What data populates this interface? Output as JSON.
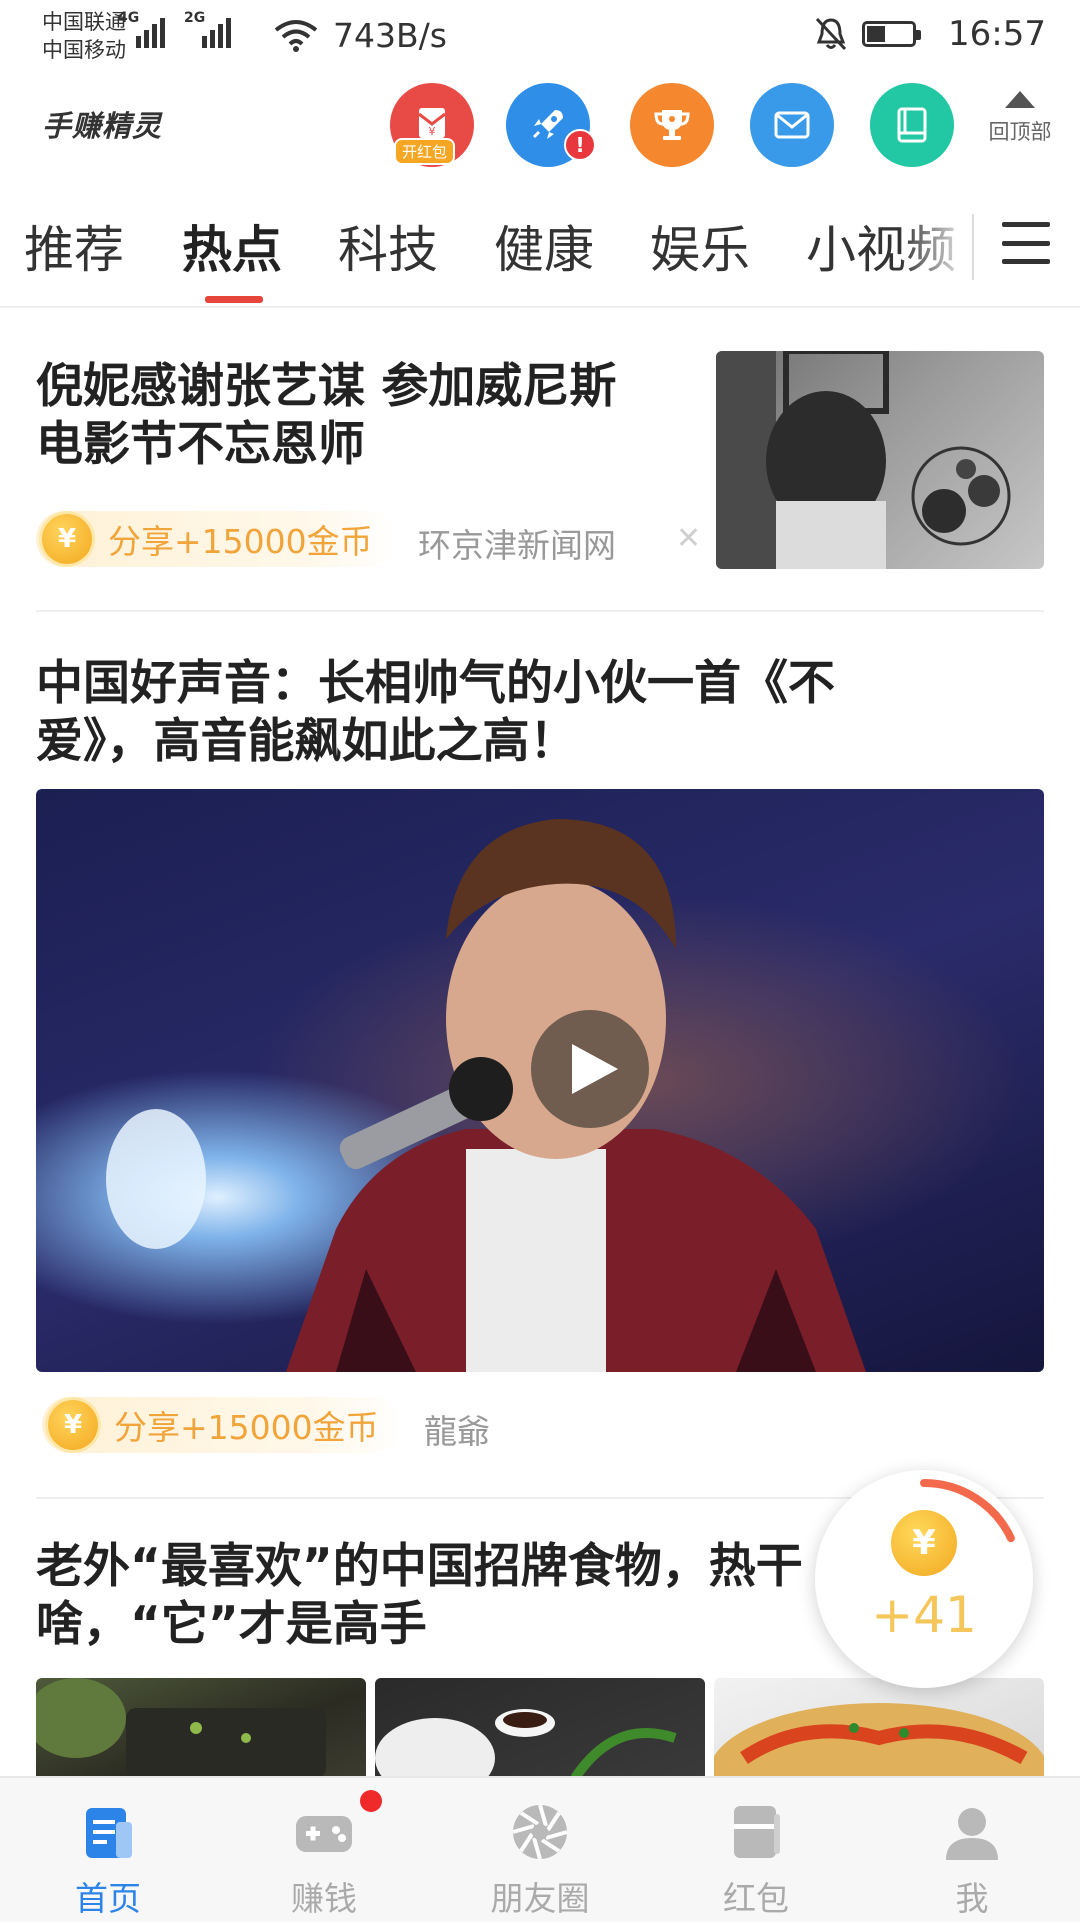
{
  "status_bar": {
    "carrier1": "中国联通",
    "carrier2": "中国移动",
    "net1": "4G",
    "net2": "2G",
    "speed": "743B/s",
    "time": "16:57",
    "icons": [
      "signal-icon",
      "wifi-icon",
      "mute-bell-icon",
      "battery-icon"
    ]
  },
  "header": {
    "logo": "手赚精灵",
    "icons": [
      {
        "name": "red-packet-icon",
        "badge": "开红包",
        "color": "#e84b46"
      },
      {
        "name": "rocket-icon",
        "alert": "!",
        "color": "#2f8ee8"
      },
      {
        "name": "trophy-icon",
        "color": "#f5882e"
      },
      {
        "name": "mail-icon",
        "color": "#3a9aea"
      },
      {
        "name": "book-icon",
        "color": "#22c7a3"
      }
    ],
    "back_top": "回顶部"
  },
  "tabs": {
    "items": [
      "推荐",
      "热点",
      "科技",
      "健康",
      "娱乐",
      "小视频"
    ],
    "active": "热点",
    "accent": "#e6453b"
  },
  "articles": [
    {
      "title_line1": "倪妮感谢张艺谋 参加威尼斯",
      "title_line2": "电影节不忘恩师",
      "reward": "分享+15000金币",
      "source": "环京津新闻网",
      "dismiss": "✕"
    },
    {
      "title_line1": "中国好声音：长相帅气的小伙一首《不",
      "title_line2": "爱》，高音能飙如此之高！",
      "reward": "分享+15000金币",
      "source": "龍爺"
    },
    {
      "title_line1": "老外“最喜欢”的中国招牌食物，热干",
      "title_line2": "啥，“它”才是高手"
    }
  ],
  "coin_symbol": "¥",
  "reward_widget": {
    "value": "+41",
    "progress": 0.18
  },
  "bottom_nav": {
    "items": [
      {
        "label": "首页",
        "icon": "home-doc-icon",
        "active": true
      },
      {
        "label": "赚钱",
        "icon": "gamepad-icon",
        "dot": true
      },
      {
        "label": "朋友圈",
        "icon": "shutter-icon"
      },
      {
        "label": "红包",
        "icon": "wallet-icon"
      },
      {
        "label": "我",
        "icon": "user-icon"
      }
    ],
    "active_color": "#2d84e8"
  }
}
